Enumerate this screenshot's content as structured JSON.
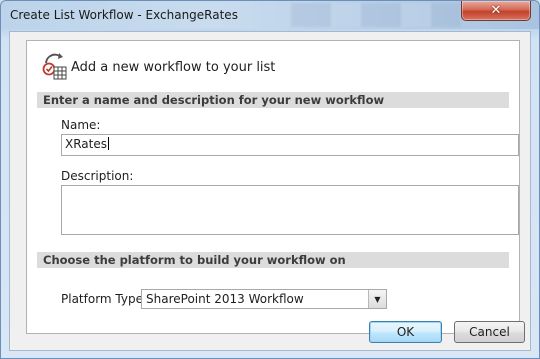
{
  "window": {
    "title": "Create List Workflow - ExchangeRates",
    "close_glyph": "✕"
  },
  "header": {
    "icon": "workflow-icon",
    "text": "Add a new workflow to your list"
  },
  "section_name": {
    "title": "Enter a name and description for your new workflow",
    "name_label": "Name:",
    "name_value": "XRates",
    "description_label": "Description:",
    "description_value": ""
  },
  "section_platform": {
    "title": "Choose the platform to build your workflow on",
    "platform_label": "Platform Type:",
    "platform_value": "SharePoint 2013 Workflow"
  },
  "buttons": {
    "ok_label": "OK",
    "cancel_label": "Cancel"
  },
  "colors": {
    "close_button": "#c2412c",
    "section_bar": "#dcdcdc",
    "default_button_border": "#3c7fb1"
  }
}
